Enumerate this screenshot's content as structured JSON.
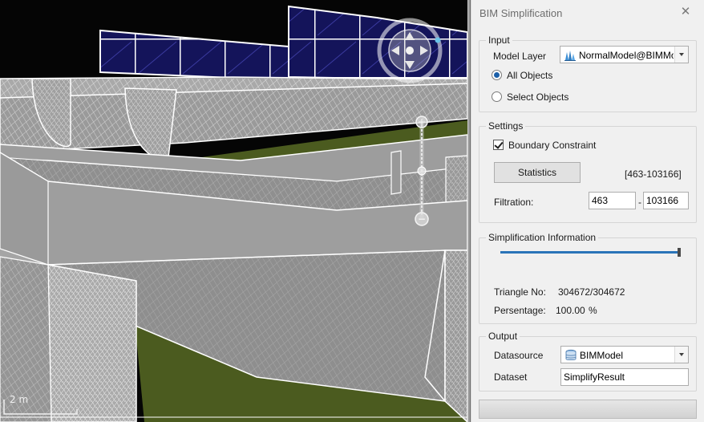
{
  "viewport": {
    "scale_label": "2 m",
    "zoom_plus": "+",
    "zoom_minus": "−"
  },
  "panel": {
    "title": "BIM Simplification",
    "close_glyph": "✕"
  },
  "input": {
    "label": "Input",
    "model_layer_label": "Model Layer",
    "model_layer_value": "NormalModel@BIMMo",
    "model_layer_icon": "bim-model-layer-icon",
    "all_objects_label": "All Objects",
    "select_objects_label": "Select Objects",
    "selected": "all"
  },
  "settings": {
    "label": "Settings",
    "boundary_label": "Boundary Constraint",
    "boundary_checked": true,
    "statistics_label": "Statistics",
    "range_text": "[463-103166]",
    "filtration_label": "Filtration:",
    "filtration_min": "463",
    "filtration_sep": "-",
    "filtration_max": "103166"
  },
  "simplification": {
    "label": "Simplification Information",
    "slider_fraction": 1.0,
    "triangle_label": "Triangle No:",
    "triangle_value": "304672/304672",
    "percentage_label": "Persentage:",
    "percentage_value": "100.00",
    "percentage_unit": "%"
  },
  "output": {
    "label": "Output",
    "datasource_label": "Datasource",
    "datasource_value": "BIMModel",
    "datasource_icon": "database-icon",
    "dataset_label": "Dataset",
    "dataset_value": "SimplifyResult"
  },
  "progress": {
    "fraction": 0.0
  },
  "colors": {
    "accent": "#2a74b8",
    "ground": "#4a5a1e",
    "model": "#9c9c9c",
    "glass": "#1a1a5e"
  }
}
